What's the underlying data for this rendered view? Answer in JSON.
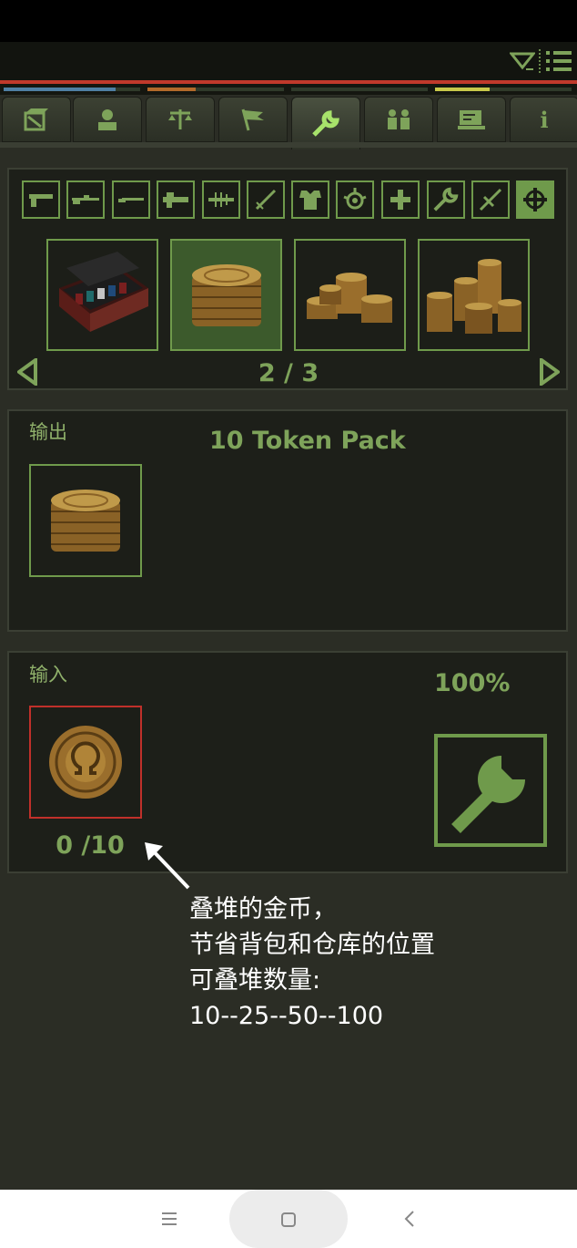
{
  "top_bar": {
    "dropdown_icon": "dropdown-triangle-icon",
    "menu_icon": "list-menu-icon"
  },
  "meters": [
    {
      "color": "#4f7fa3",
      "value": 0.82
    },
    {
      "color": "#b26a2a",
      "value": 0.35
    },
    {
      "color": "#2f3a2a",
      "value": 0.0
    },
    {
      "color": "#c8c84a",
      "value": 0.4
    }
  ],
  "tabs": [
    {
      "name": "inventory",
      "icon": "box-icon"
    },
    {
      "name": "character",
      "icon": "person-icon"
    },
    {
      "name": "trade",
      "icon": "scales-icon"
    },
    {
      "name": "quests",
      "icon": "flag-icon"
    },
    {
      "name": "crafting",
      "icon": "wrench-icon",
      "active": true
    },
    {
      "name": "party",
      "icon": "people-icon"
    },
    {
      "name": "terminal",
      "icon": "computer-icon"
    },
    {
      "name": "info",
      "icon": "info-icon",
      "glyph": "i"
    }
  ],
  "categories": [
    {
      "name": "pistol",
      "icon": "pistol-icon"
    },
    {
      "name": "rifle",
      "icon": "rifle-icon"
    },
    {
      "name": "shotgun",
      "icon": "shotgun-icon"
    },
    {
      "name": "heavy",
      "icon": "heavy-gun-icon"
    },
    {
      "name": "energy",
      "icon": "energy-gun-icon"
    },
    {
      "name": "melee",
      "icon": "sword-icon"
    },
    {
      "name": "armor",
      "icon": "armor-icon"
    },
    {
      "name": "chems",
      "icon": "chem-icon"
    },
    {
      "name": "medical",
      "icon": "plus-icon"
    },
    {
      "name": "tools",
      "icon": "wrench-icon"
    },
    {
      "name": "misc",
      "icon": "knife-icon"
    },
    {
      "name": "special",
      "icon": "crosshair-icon",
      "active": true
    }
  ],
  "recipes": [
    {
      "name": "token-case",
      "selected": false
    },
    {
      "name": "10-token-pack",
      "selected": true
    },
    {
      "name": "25-token-pack",
      "selected": false
    },
    {
      "name": "50-token-pack",
      "selected": false
    }
  ],
  "pager": {
    "text": "2 / 3"
  },
  "output": {
    "label": "输出",
    "title": "10 Token Pack"
  },
  "input": {
    "label": "输入",
    "success": "100%",
    "count": "0 /10"
  },
  "note": {
    "lines": [
      "叠堆的金币，",
      "节省背包和仓库的位置",
      "可叠堆数量:",
      "10--25--50--100"
    ]
  },
  "nav": {
    "recents_icon": "menu-lines-icon",
    "home_icon": "square-icon",
    "back_icon": "back-chevron-icon"
  }
}
